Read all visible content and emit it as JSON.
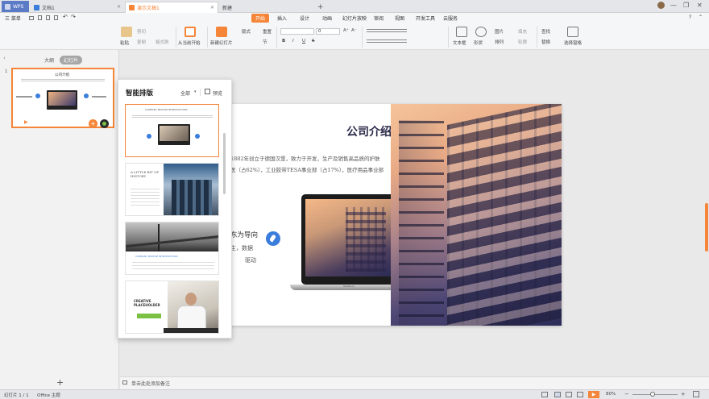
{
  "tabs": {
    "wps": "WPS",
    "doc": "文档1",
    "ppt": "演示文稿1",
    "new": "新建",
    "add": "+"
  },
  "menu": {
    "file": "三 菜单",
    "items": [
      "开始",
      "插入",
      "设计",
      "动画",
      "幻灯片放映",
      "审阅",
      "视图",
      "开发工具",
      "云服务"
    ]
  },
  "ribbon": {
    "paste": "粘贴",
    "cut": "剪切",
    "copy": "复制",
    "format_painter": "格式刷",
    "from_current": "从当前开始",
    "new_slide": "新建幻灯片",
    "layout": "版式",
    "section": "节",
    "reset": "重置",
    "font_size": "0",
    "textbox": "文本框",
    "shape": "形状",
    "arrange": "排列",
    "picture": "图片",
    "fill": "填充",
    "outline": "轮廓",
    "find": "查找",
    "replace": "替换",
    "select_pane": "选择窗格",
    "bold": "B",
    "italic": "I",
    "underline": "U",
    "strike": "S"
  },
  "left_pane": {
    "tab_outline": "大纲",
    "tab_slides": "幻灯片",
    "slide_number": "1",
    "thumb_title": "公司介绍",
    "add_slide": "+"
  },
  "layout_panel": {
    "title": "智能排版",
    "filter": "全部",
    "preview": "预览",
    "items": [
      {
        "heading": "COMPANY PROFILE INTRODUCTION"
      },
      {
        "heading": "A LITTLE BIT OF HISTORY"
      },
      {
        "heading": "COMPANY PROFILE INTRODUCTION"
      },
      {
        "heading": "CREATIVE PLACEHOLDER"
      }
    ]
  },
  "slide": {
    "title": "公司介绍",
    "line1": "1882年创立于德国汉堡，致力于开发，生产及销售高品质的护肤",
    "line2": "医（占62%），工业胶带TESA事业部（占17%），医疗用品事业部",
    "side1": "东为导向",
    "side2": "主，数据",
    "side3": "驱动",
    "laptop_brand": "MacBook"
  },
  "notes": {
    "placeholder": "单击此处添加备注"
  },
  "status": {
    "slide_info": "幻灯片 1 / 1",
    "theme": "Office 主题",
    "zoom": "80%",
    "zoom_minus": "−",
    "zoom_plus": "+"
  },
  "colors": {
    "accent": "#f58538",
    "wps_blue": "#5b7bc6",
    "icon_blue": "#3b7ddd"
  }
}
